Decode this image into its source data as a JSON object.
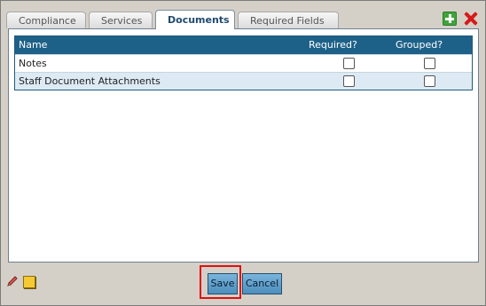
{
  "tabs": [
    {
      "label": "Compliance",
      "active": false
    },
    {
      "label": "Services",
      "active": false
    },
    {
      "label": "Documents",
      "active": true
    },
    {
      "label": "Required Fields",
      "active": false
    }
  ],
  "toolbar": {
    "add_icon": "plus-icon",
    "delete_icon": "x-icon"
  },
  "grid": {
    "columns": [
      "Name",
      "Required?",
      "Grouped?"
    ],
    "rows": [
      {
        "name": "Notes",
        "required": false,
        "grouped": false
      },
      {
        "name": "Staff Document Attachments",
        "required": false,
        "grouped": false
      }
    ]
  },
  "footer": {
    "edit_icon": "pencil-icon",
    "note_icon": "note-icon",
    "save_label": "Save",
    "cancel_label": "Cancel"
  },
  "colors": {
    "header_bg": "#1e6188",
    "alt_row_bg": "#ddeaf4",
    "button_bg": "#5b9ccb",
    "highlight": "#e01010"
  }
}
